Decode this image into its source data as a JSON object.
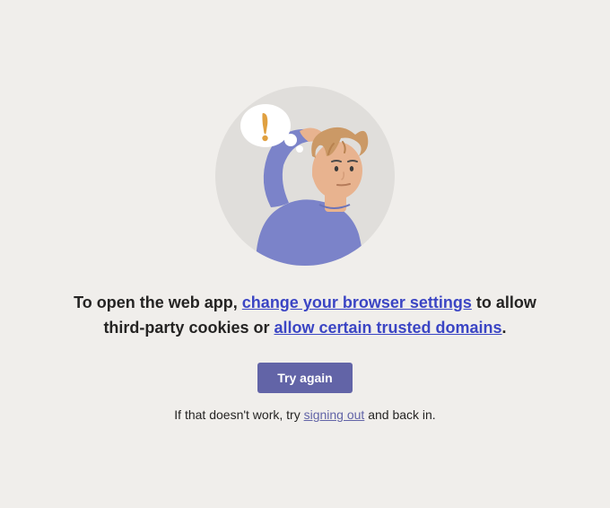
{
  "illustration": {
    "name": "confused-person-illustration"
  },
  "message": {
    "prefix": "To open the web app, ",
    "link1": "change your browser settings",
    "mid": " to allow third-party cookies or ",
    "link2": "allow certain trusted domains",
    "suffix": "."
  },
  "button": {
    "label": "Try again"
  },
  "subtext": {
    "prefix": "If that doesn't work, try ",
    "link": "signing out",
    "suffix": " and back in."
  }
}
